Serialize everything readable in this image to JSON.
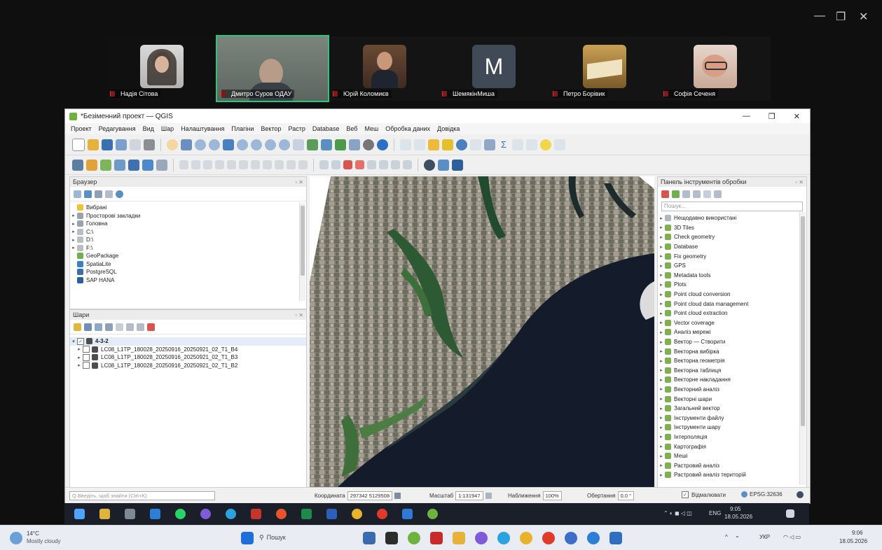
{
  "meeting": {
    "participants": [
      {
        "name": "Надія Сітова",
        "initial": ""
      },
      {
        "name": "Дмитро Суров ОДАУ",
        "initial": ""
      },
      {
        "name": "Юрій Коломиєв",
        "initial": ""
      },
      {
        "name": "ШемякінМиша",
        "initial": "M"
      },
      {
        "name": "Петро Борівик",
        "initial": ""
      },
      {
        "name": "Софія Сеченя",
        "initial": ""
      }
    ],
    "window_controls": {
      "minimize": "—",
      "restore": "❐",
      "close": "✕"
    }
  },
  "qgis": {
    "title": "*Безіменний проект — QGIS",
    "title_controls": {
      "minimize": "—",
      "restore": "❐",
      "close": "✕"
    },
    "menu": [
      "Проект",
      "Редагування",
      "Вид",
      "Шар",
      "Налаштування",
      "Плагіни",
      "Вектор",
      "Растр",
      "Database",
      "Веб",
      "Меш",
      "Обробка даних",
      "Довідка"
    ],
    "browser_panel": {
      "title": "Браузер",
      "items": [
        {
          "label": "Вибрані",
          "arrow": "",
          "color": "#f2c12e"
        },
        {
          "label": "Просторові закладки",
          "arrow": "▸",
          "color": "#9aa3ad"
        },
        {
          "label": "Головна",
          "arrow": "▸",
          "color": "#9aa3ad"
        },
        {
          "label": "C:\\",
          "arrow": "▸",
          "color": "#b9bec4"
        },
        {
          "label": "D:\\",
          "arrow": "▸",
          "color": "#b9bec4"
        },
        {
          "label": "F:\\",
          "arrow": "▸",
          "color": "#b9bec4"
        },
        {
          "label": "GeoPackage",
          "arrow": "",
          "color": "#6fae52"
        },
        {
          "label": "SpatiaLite",
          "arrow": "",
          "color": "#3a7fc9"
        },
        {
          "label": "PostgreSQL",
          "arrow": "",
          "color": "#3b6fa8"
        },
        {
          "label": "SAP HANA",
          "arrow": "",
          "color": "#2c5fa0"
        }
      ]
    },
    "layers_panel": {
      "title": "Шари",
      "group": "4-3-2",
      "layers": [
        "LC08_L1TP_180028_20250916_20250921_02_T1_B4",
        "LC08_L1TP_180028_20250916_20250921_02_T1_B3",
        "LC08_L1TP_180028_20250916_20250921_02_T1_B2"
      ]
    },
    "toolbox_panel": {
      "title": "Панель інструментів обробки",
      "search_placeholder": "Пошук...",
      "items": [
        "Нещодавно використані",
        "3D Tiles",
        "Check geometry",
        "Database",
        "Fix geometry",
        "GPS",
        "Metadata tools",
        "Plots",
        "Point cloud conversion",
        "Point cloud data management",
        "Point cloud extraction",
        "Vector coverage",
        "Аналіз мережі",
        "Вектор — Створити",
        "Векторна вибірка",
        "Векторна геометрія",
        "Векторна таблиця",
        "Векторне накладання",
        "Векторний аналіз",
        "Векторні шари",
        "Загальний вектор",
        "Інструменти файлу",
        "Інструменти шару",
        "Інтерполяція",
        "Картографія",
        "Меші",
        "Растровий аналіз",
        "Растровий аналіз територій"
      ]
    },
    "statusbar": {
      "locator_placeholder": "Q  Введіть, щоб знайти (Ctrl+K)",
      "coord_label": "Координата",
      "coord_value": "297342  5129508",
      "scale_label": "Масштаб",
      "scale_value": "1:131947",
      "magnifier_label": "Наближення",
      "magnifier_value": "100%",
      "rotation_label": "Обертання",
      "rotation_value": "0,0 °",
      "render_label": "Відмалювати",
      "crs": "EPSG:32636"
    }
  },
  "remote_taskbar": {
    "time": "9:05",
    "date": "18.05.2026",
    "lang": "ENG"
  },
  "local_taskbar": {
    "weather_temp": "14°C",
    "weather_desc": "Mostly cloudy",
    "search_label": "Пошук",
    "lang": "УКР",
    "time": "9:06",
    "date": "18.05.2026"
  }
}
